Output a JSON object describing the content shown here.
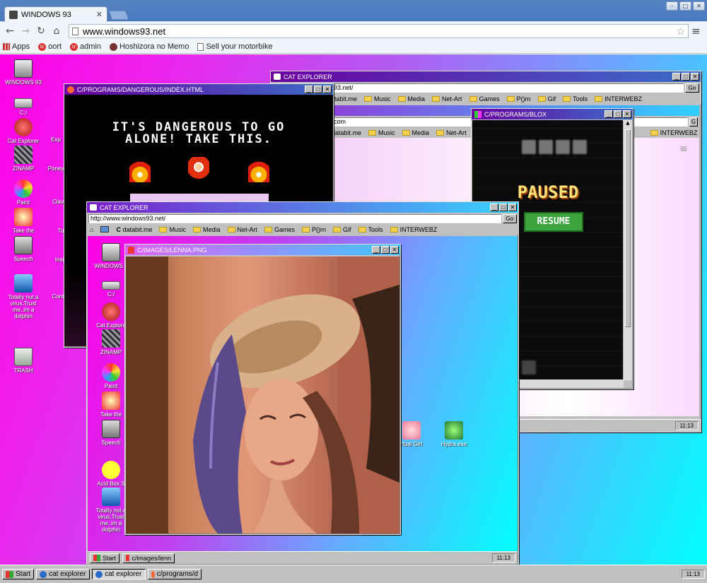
{
  "browser": {
    "tab_title": "WINDOWS 93",
    "url": "www.windows93.net",
    "bookmarks": [
      "Apps",
      "oort",
      "admin",
      "Hoshizora no Memo",
      "Sell your motorbike"
    ]
  },
  "desktop_icons": [
    {
      "label": "WINDOWS 93"
    },
    {
      "label": "C:/"
    },
    {
      "label": "Cat Explorer"
    },
    {
      "label": "ZINAMP"
    },
    {
      "label": "Paint"
    },
    {
      "label": "Take the"
    },
    {
      "label": "Speech"
    },
    {
      "label": "Totally not a virus.Trust me..im a dolphin"
    },
    {
      "label": "TRASH"
    }
  ],
  "cat_explorer_back": {
    "title": "CAT EXPLORER",
    "url_partial": "93.net/",
    "go": "Go",
    "bookmarks": [
      "Music",
      "Media",
      "Net-Art",
      "Games",
      "P()rn",
      "Gif",
      "Tools",
      "INTERWEBZ"
    ],
    "bookmark_first": "tabit.me",
    "second_url": "com",
    "second_bookmarks": [
      "databit.me",
      "Music",
      "Media",
      "Net-Art",
      "INTERWEBZ"
    ],
    "clock": "11:13"
  },
  "dangerous": {
    "title": "C/PROGRAMS/DANGEROUS/INDEX.HTML",
    "line1": "IT'S DANGEROUS TO GO",
    "line2": "ALONE! TAKE THIS."
  },
  "blox": {
    "title": "C/PROGRAMS/BLOX",
    "paused": "PAUSED",
    "resume": "RESUME"
  },
  "cat_explorer_front": {
    "title": "CAT EXPLORER",
    "url": "http://www.windows93.net/",
    "go": "Go",
    "bookmarks": [
      "databit.me",
      "Music",
      "Media",
      "Net-Art",
      "Games",
      "P()rn",
      "Gif",
      "Tools",
      "INTERWEBZ"
    ],
    "icons": [
      "WINDOWS 9",
      "C:/",
      "Cat Explore",
      "ZINAMP",
      "Paint",
      "Take the",
      "Speech",
      "Acid Box S",
      "Totally not a virus.Trust me..im a dolphin"
    ],
    "right_icons": [
      "rtual Girl",
      "Hydra.exe"
    ],
    "start": "Start",
    "task": "c/images/lenn",
    "clock": "11:13"
  },
  "lenna": {
    "title": "C/IMAGES/LENNA.PNG"
  },
  "back_icons_partial": [
    "Exp",
    "Poney",
    "Clav",
    "Tu",
    "Insi",
    "Cont"
  ],
  "taskbar": {
    "start": "Start",
    "items": [
      "cat explorer",
      "cat explorer",
      "c/programs/d"
    ],
    "clock": "11:13"
  },
  "colors": {
    "accent_magenta": "#ff00e6",
    "accent_cyan": "#00ffff",
    "win_gray": "#c0c0c0"
  }
}
